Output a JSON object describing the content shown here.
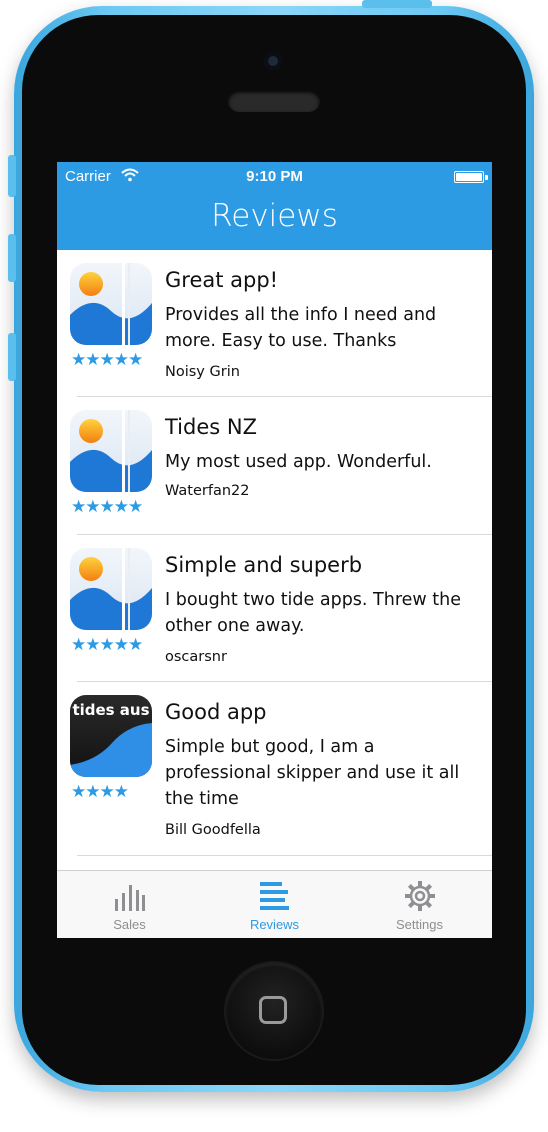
{
  "status_bar": {
    "carrier": "Carrier",
    "time": "9:10 PM"
  },
  "nav": {
    "title": "Reviews"
  },
  "reviews": [
    {
      "title": "Great app!",
      "body": "Provides all the info I need and more. Easy to use. Thanks",
      "author": "Noisy Grin",
      "stars": "★★★★★",
      "rating": 5,
      "icon": "tides-nz-app-icon"
    },
    {
      "title": "Tides NZ",
      "body": "My most used app. Wonderful.",
      "author": "Waterfan22",
      "stars": "★★★★★",
      "rating": 5,
      "icon": "tides-nz-app-icon"
    },
    {
      "title": "Simple and superb",
      "body": "I bought two tide apps. Threw the other one away.",
      "author": "oscarsnr",
      "stars": "★★★★★",
      "rating": 5,
      "icon": "tides-nz-app-icon"
    },
    {
      "title": "Good app",
      "body": "Simple but good, I am a professional skipper and use it all the time",
      "author": "Bill Goodfella",
      "stars": "★★★★",
      "rating": 4,
      "icon": "tides-aus-app-icon",
      "icon_text": "tides aus"
    }
  ],
  "tabbar": {
    "tabs": [
      {
        "label": "Sales",
        "icon": "bar-chart-icon",
        "selected": false
      },
      {
        "label": "Reviews",
        "icon": "list-lines-icon",
        "selected": true
      },
      {
        "label": "Settings",
        "icon": "gear-icon",
        "selected": false
      }
    ]
  },
  "colors": {
    "accent": "#2d9be3",
    "shell": "#6cc9f3",
    "star": "#2d9be3",
    "tab_inactive": "#8e8e93"
  }
}
